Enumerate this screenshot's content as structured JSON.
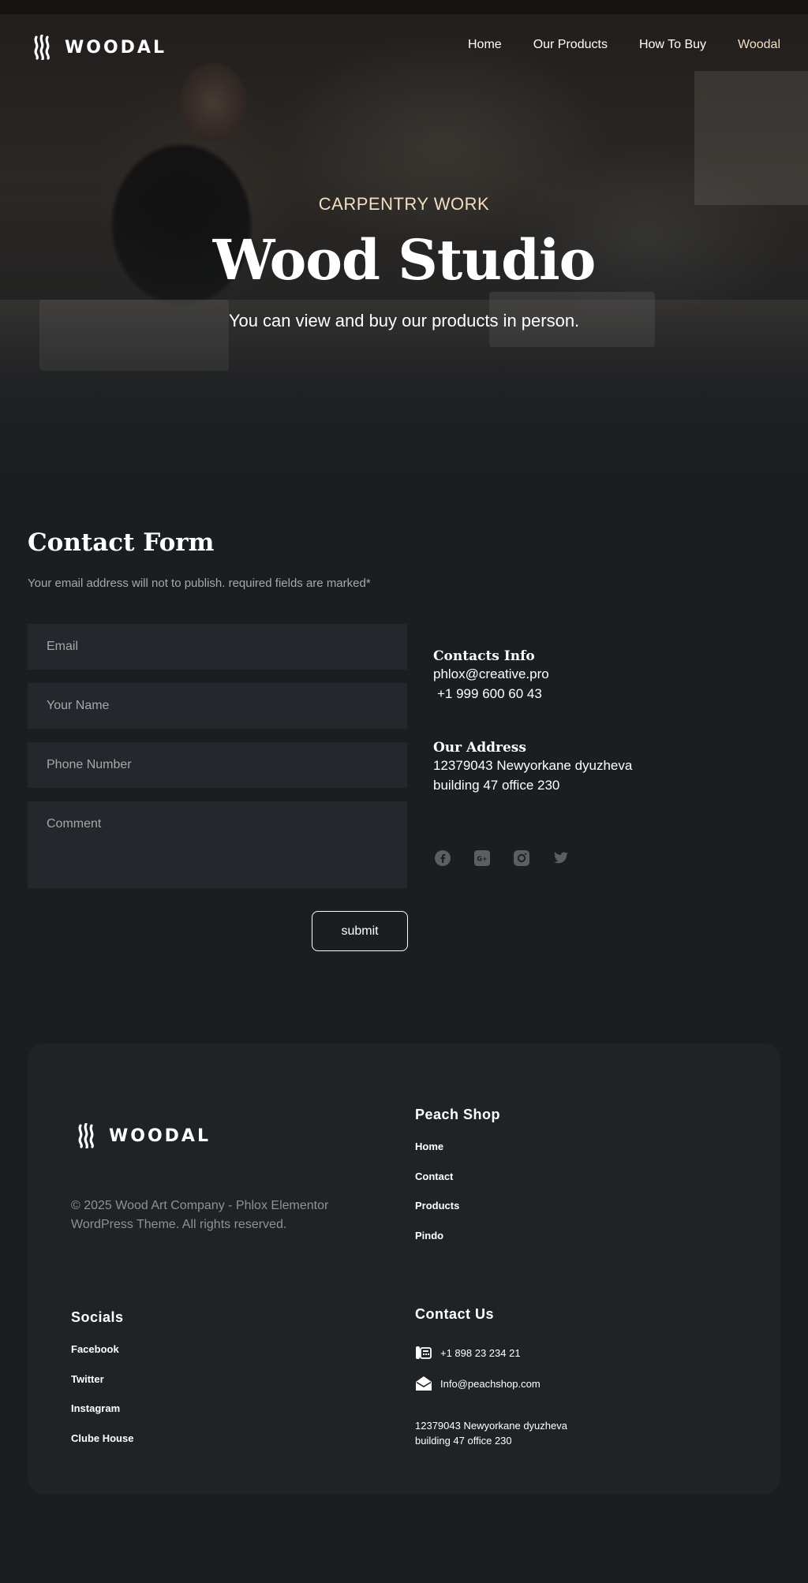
{
  "brand": {
    "name": "WOODAL"
  },
  "nav": {
    "links": [
      {
        "label": "Home"
      },
      {
        "label": "Our Products"
      },
      {
        "label": "How To Buy"
      },
      {
        "label": "Woodal"
      }
    ],
    "active_color": "#f1dfc1"
  },
  "hero": {
    "eyebrow": "CARPENTRY WORK",
    "title": "Wood Studio",
    "description": "You can view and buy our products in person."
  },
  "contact_form": {
    "title": "Contact Form",
    "description": "Your email address will not to publish. required fields are marked*",
    "fields": {
      "email_placeholder": "Email",
      "name_placeholder": "Your Name",
      "phone_placeholder": "Phone Number",
      "comment_placeholder": "Comment"
    },
    "submit_label": "submit"
  },
  "contacts_info": {
    "title": "Contacts Info",
    "email": "phlox@creative.pro",
    "phone": "+1 999 600 60 43"
  },
  "address": {
    "title": "Our Address",
    "line1": "12379043 Newyorkane dyuzheva",
    "line2": "building 47 office 230"
  },
  "social_icons": [
    "facebook-icon",
    "google-plus-icon",
    "instagram-icon",
    "twitter-icon"
  ],
  "footer": {
    "copyright": "© 2025 Wood Art Company - Phlox Elementor WordPress Theme. All rights reserved.",
    "shop": {
      "title": "Peach Shop",
      "links": [
        "Home",
        "Contact",
        "Products",
        "Pindo"
      ]
    },
    "socials": {
      "title": "Socials",
      "links": [
        "Facebook",
        "Twitter",
        "Instagram",
        "Clube House"
      ]
    },
    "contact": {
      "title": "Contact Us",
      "phone": "+1 898 23 234 21",
      "email": "Info@peachshop.com",
      "address_line1": "12379043 Newyorkane dyuzheva",
      "address_line2": "building 47 office 230"
    }
  },
  "colors": {
    "background": "#1b1e21",
    "accent": "#f1dfc1",
    "field": "#24272b",
    "footer_card": "#202326"
  }
}
